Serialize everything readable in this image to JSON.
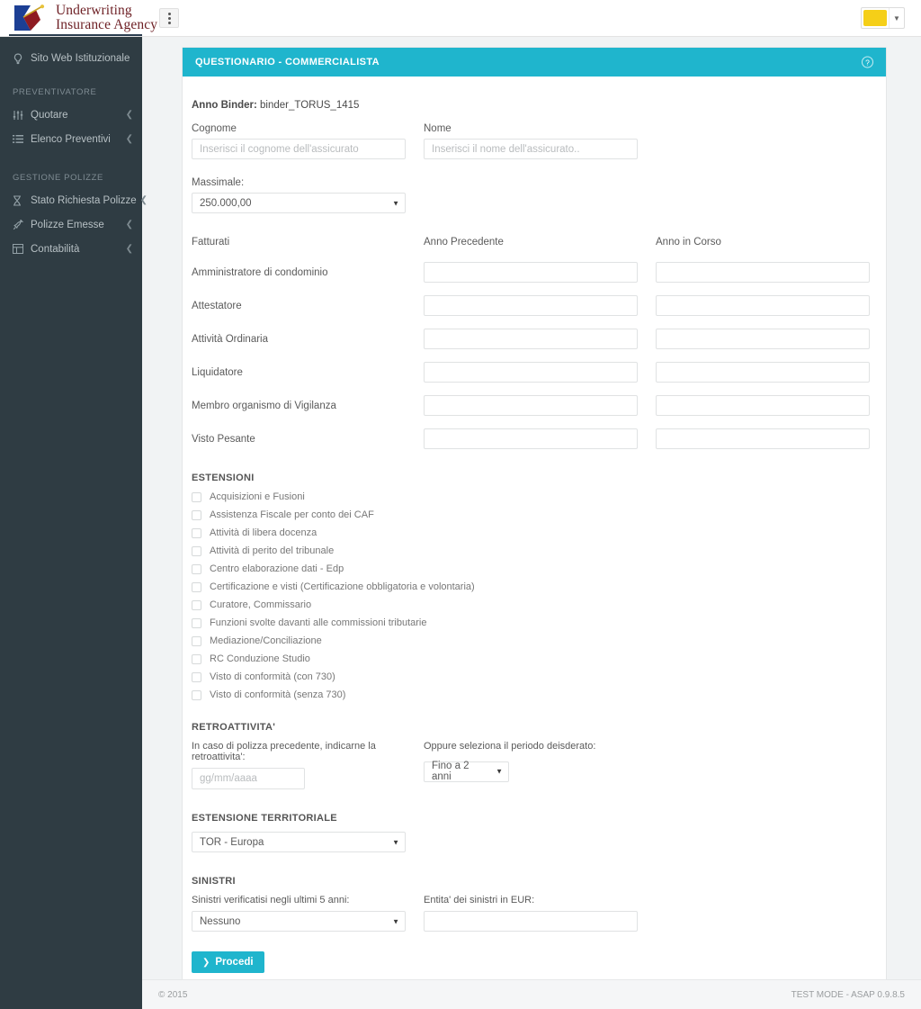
{
  "brand": {
    "logo_line1": "Underwriting",
    "logo_line2": "Insurance Agency",
    "accent_teal": "#1fb5cd",
    "sidebar_bg": "#2f3c43",
    "swatch_color": "#f5cf18"
  },
  "topbar": {
    "toggle_icon": "vertical-ellipsis-icon",
    "color_swatch_value": "#f5cf18",
    "caret_icon": "chevron-down-icon"
  },
  "sidebar": {
    "top_link": {
      "label": "Sito Web Istituzionale",
      "icon": "lightbulb-icon"
    },
    "groups": [
      {
        "header": "PREVENTIVATORE",
        "items": [
          {
            "label": "Quotare",
            "icon": "sliders-icon",
            "caret": "chevron-left-icon"
          },
          {
            "label": "Elenco Preventivi",
            "icon": "list-icon",
            "caret": "chevron-left-icon"
          }
        ]
      },
      {
        "header": "GESTIONE POLIZZE",
        "items": [
          {
            "label": "Stato Richiesta Polizze",
            "icon": "hourglass-icon",
            "caret": "chevron-left-icon"
          },
          {
            "label": "Polizze Emesse",
            "icon": "rocket-icon",
            "caret": "chevron-left-icon"
          },
          {
            "label": "Contabilità",
            "icon": "table-icon",
            "caret": "chevron-left-icon"
          }
        ]
      }
    ]
  },
  "panel": {
    "title": "QUESTIONARIO - COMMERCIALISTA",
    "help_icon": "question-mark-circle-icon"
  },
  "form": {
    "anno_binder_label": "Anno Binder:",
    "anno_binder_value": "binder_TORUS_1415",
    "cognome": {
      "label": "Cognome",
      "value": "",
      "placeholder": "Inserisci il cognome dell'assicurato"
    },
    "nome": {
      "label": "Nome",
      "value": "",
      "placeholder": "Inserisci il nome dell'assicurato.."
    },
    "massimale": {
      "label": "Massimale:",
      "selected": "250.000,00",
      "caret": "caret-down-icon"
    },
    "fatturati": {
      "col1_header": "Fatturati",
      "col2_header": "Anno Precedente",
      "col3_header": "Anno in Corso",
      "rows": [
        {
          "label": "Amministratore di condominio",
          "anno_precedente": "",
          "anno_in_corso": ""
        },
        {
          "label": "Attestatore",
          "anno_precedente": "",
          "anno_in_corso": ""
        },
        {
          "label": "Attività  Ordinaria",
          "anno_precedente": "",
          "anno_in_corso": ""
        },
        {
          "label": "Liquidatore",
          "anno_precedente": "",
          "anno_in_corso": ""
        },
        {
          "label": "Membro organismo di Vigilanza",
          "anno_precedente": "",
          "anno_in_corso": ""
        },
        {
          "label": "Visto Pesante",
          "anno_precedente": "",
          "anno_in_corso": ""
        }
      ]
    },
    "estensioni": {
      "title": "ESTENSIONI",
      "items": [
        {
          "label": "Acquisizioni e Fusioni",
          "checked": false
        },
        {
          "label": "Assistenza Fiscale per conto dei CAF",
          "checked": false
        },
        {
          "label": "Attività di libera docenza",
          "checked": false
        },
        {
          "label": "Attività di perito del tribunale",
          "checked": false
        },
        {
          "label": "Centro elaborazione dati - Edp",
          "checked": false
        },
        {
          "label": "Certificazione e visti (Certificazione obbligatoria e volontaria)",
          "checked": false
        },
        {
          "label": "Curatore, Commissario",
          "checked": false
        },
        {
          "label": "Funzioni svolte davanti alle commissioni tributarie",
          "checked": false
        },
        {
          "label": "Mediazione/Conciliazione",
          "checked": false
        },
        {
          "label": "RC Conduzione Studio",
          "checked": false
        },
        {
          "label": "Visto di conformità (con 730)",
          "checked": false
        },
        {
          "label": "Visto di conformità (senza 730)",
          "checked": false
        }
      ]
    },
    "retroattivita": {
      "title": "RETROATTIVITA'",
      "date_label": "In caso di polizza precedente, indicarne la retroattivita':",
      "date_value": "",
      "date_placeholder": "gg/mm/aaaa",
      "period_label": "Oppure seleziona il periodo deisderato:",
      "period_selected": "Fino a 2 anni",
      "caret": "caret-down-icon"
    },
    "estensione_territoriale": {
      "title": "ESTENSIONE TERRITORIALE",
      "selected": "TOR - Europa",
      "caret": "caret-down-icon"
    },
    "sinistri": {
      "title": "SINISTRI",
      "count_label": "Sinistri verificatisi negli ultimi 5 anni:",
      "count_selected": "Nessuno",
      "caret": "caret-down-icon",
      "amount_label": "Entita' dei sinistri in EUR:",
      "amount_value": ""
    },
    "submit": {
      "label": "Procedi",
      "icon": "chevron-right-icon"
    }
  },
  "footer": {
    "copyright": "© 2015",
    "version": "TEST MODE - ASAP 0.9.8.5"
  }
}
